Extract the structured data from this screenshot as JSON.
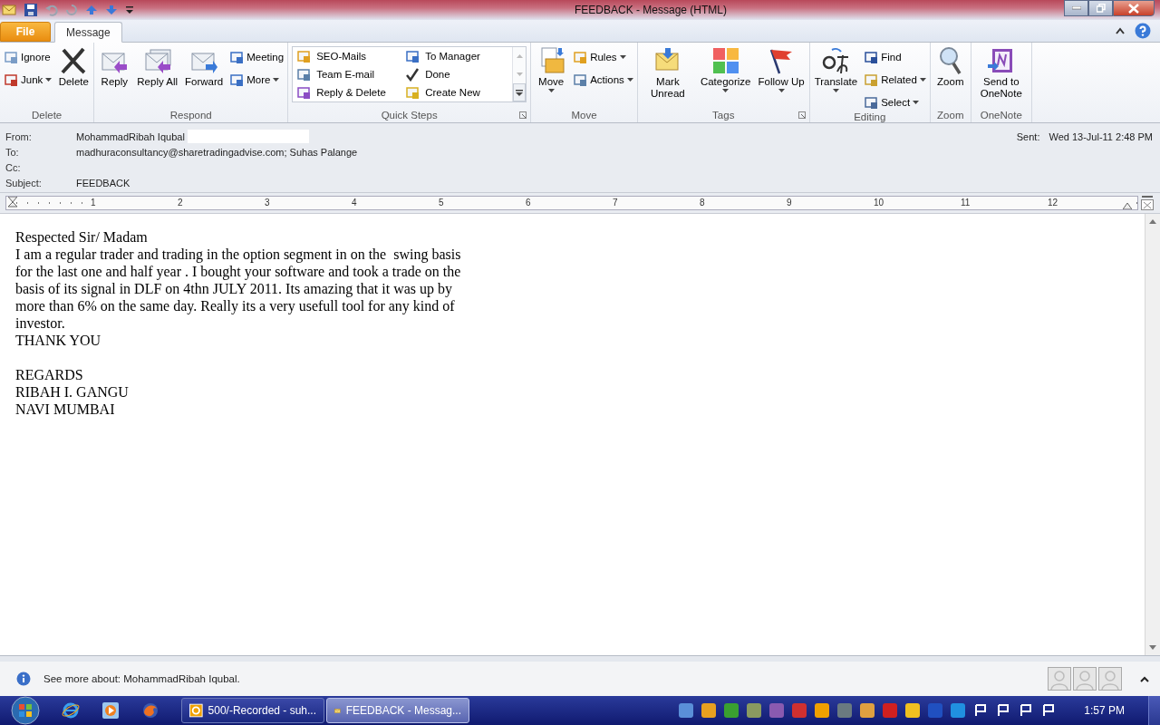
{
  "window": {
    "title": "FEEDBACK - Message (HTML)"
  },
  "tabs": [
    {
      "label": "File",
      "kind": "file",
      "selected": false
    },
    {
      "label": "Message",
      "kind": "tab",
      "selected": true
    }
  ],
  "ribbon": [
    {
      "label": "Delete",
      "launcher": false,
      "items": [
        {
          "kind": "stack",
          "items": [
            {
              "label": "Ignore",
              "dropdown": false
            },
            {
              "label": "Junk",
              "dropdown": true
            }
          ]
        },
        {
          "kind": "large",
          "label": "Delete",
          "dropdown": false
        }
      ]
    },
    {
      "label": "Respond",
      "launcher": false,
      "items": [
        {
          "kind": "large",
          "label": "Reply",
          "dropdown": false
        },
        {
          "kind": "large",
          "label": "Reply All",
          "dropdown": false
        },
        {
          "kind": "large",
          "label": "Forward",
          "dropdown": false
        },
        {
          "kind": "stack",
          "items": [
            {
              "label": "Meeting",
              "dropdown": false
            },
            {
              "label": "More",
              "dropdown": true
            }
          ]
        }
      ]
    },
    {
      "label": "Quick Steps",
      "launcher": true,
      "items": [
        {
          "kind": "gallery",
          "items": [
            {
              "label": "SEO-Mails"
            },
            {
              "label": "To Manager"
            },
            {
              "label": "Team E-mail"
            },
            {
              "label": "Done"
            },
            {
              "label": "Reply & Delete"
            },
            {
              "label": "Create New"
            }
          ]
        }
      ]
    },
    {
      "label": "Move",
      "launcher": false,
      "items": [
        {
          "kind": "large",
          "label": "Move",
          "dropdown": true
        },
        {
          "kind": "stack",
          "items": [
            {
              "label": "Rules",
              "dropdown": true
            },
            {
              "label": "Actions",
              "dropdown": true
            }
          ]
        }
      ]
    },
    {
      "label": "Tags",
      "launcher": true,
      "items": [
        {
          "kind": "large",
          "label": "Mark Unread",
          "dropdown": false
        },
        {
          "kind": "large",
          "label": "Categorize",
          "dropdown": true
        },
        {
          "kind": "large",
          "label": "Follow Up",
          "dropdown": true
        }
      ]
    },
    {
      "label": "Editing",
      "launcher": false,
      "items": [
        {
          "kind": "large",
          "label": "Translate",
          "dropdown": true
        },
        {
          "kind": "stack",
          "items": [
            {
              "label": "Find",
              "dropdown": false
            },
            {
              "label": "Related",
              "dropdown": true
            },
            {
              "label": "Select",
              "dropdown": true
            }
          ]
        }
      ]
    },
    {
      "label": "Zoom",
      "launcher": false,
      "items": [
        {
          "kind": "large",
          "label": "Zoom",
          "dropdown": false
        }
      ]
    },
    {
      "label": "OneNote",
      "launcher": false,
      "items": [
        {
          "kind": "large",
          "label": "Send to OneNote",
          "dropdown": false
        }
      ]
    }
  ],
  "header": {
    "fields": [
      {
        "label": "From:",
        "value": "MohammadRibah Iqubal"
      },
      {
        "label": "To:",
        "value": "madhuraconsultancy@sharetradingadvise.com; Suhas Palange"
      },
      {
        "label": "Cc:"
      },
      {
        "label": "Subject:",
        "value": "FEEDBACK"
      }
    ],
    "sent": {
      "label": "Sent:",
      "value": "Wed 13-Jul-11 2:48 PM"
    }
  },
  "ruler": {
    "marks": [
      "1",
      "2",
      "3",
      "4",
      "5",
      "6",
      "7",
      "8",
      "9",
      "10",
      "11",
      "12"
    ]
  },
  "body": {
    "blocks": [
      {
        "lines": [
          "Respected Sir/ Madam",
          "I am a regular trader and trading in the option segment in on the  swing basis for the last one and half year . I bought your software and took a trade on the basis of its signal in DLF on 4thn JULY 2011. Its amazing that it was up by more than 6% on the same day. Really its a very usefull tool for any kind of investor.",
          "THANK YOU"
        ]
      },
      {
        "lines": [
          "REGARDS",
          "RIBAH I. GANGU",
          "NAVI MUMBAI"
        ]
      }
    ]
  },
  "info_bar": {
    "text": "See more about: MohammadRibah Iqubal."
  },
  "taskbar": {
    "tasks": [
      {
        "label": "500/-Recorded - suh...",
        "selected": false
      },
      {
        "label": "FEEDBACK - Messag...",
        "selected": true
      }
    ],
    "clock": "1:57 PM"
  }
}
